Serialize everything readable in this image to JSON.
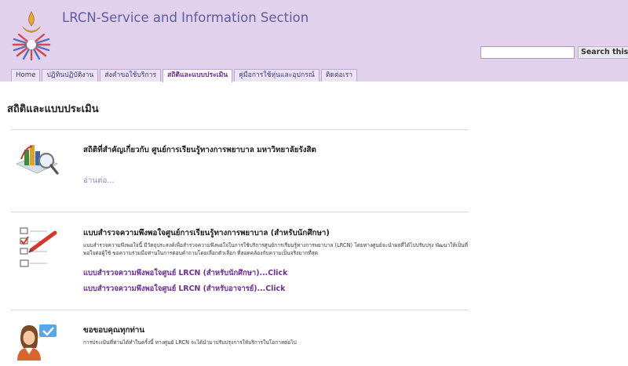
{
  "site": {
    "title": "LRCN-Service and Information Section"
  },
  "search": {
    "placeholder": "",
    "button_label": "Search this site"
  },
  "nav": {
    "tabs": [
      {
        "label": "Home"
      },
      {
        "label": "ปฏิทินปฏิบัติงาน"
      },
      {
        "label": "ส่งคำขอใช้บริการ"
      },
      {
        "label": "สถิติและแบบประเมิน"
      },
      {
        "label": "คู่มือการใช้หุ่นและอุปกรณ์"
      },
      {
        "label": "ติดต่อเรา"
      }
    ],
    "active_index": 3
  },
  "page": {
    "title": "สถิติและแบบประเมิน"
  },
  "sections": {
    "stats": {
      "heading": "สถิติที่สำคัญเกี่ยวกับ ศูนย์การเรียนรู้ทางการพยาบาล มหาวิทยาลัยรังสิต",
      "read_more": "อ่านต่อ...",
      "icon": "chart-magnifier-icon"
    },
    "survey": {
      "heading": "แบบสำรวจความพึงพอใจศูนย์การเรียนรู้ทางการพยาบาล (สำหรับนักศึกษา)",
      "description": "แบบสำรวจความพึงพอใจนี้ มีวัตถุประสงค์เพื่อสำรวจความพึงพอใจในการใช้บริการศูนย์การเรียนรู้ทางการพยาบาล (LRCN) โดยทางศูนย์จะนำผลที่ได้ไปปรับปรุง พัฒนาให้เป็นที่พอใจต่อผู้ใช้ ขอความร่วมมือท่านในการตอบคำถามโดยเลือกตัวเลือก ที่สอดคล้องกับความเป็นจริงมากที่สุด",
      "links": [
        {
          "label": "แบบสำรวจความพึงพอใจศูนย์ LRCN (สำหรับนักศึกษา)...Click"
        },
        {
          "label": "แบบสำรวจความพึงพอใจศูนย์ LRCN (สำหรับอาจารย์)...Click"
        }
      ],
      "icon": "checklist-icon"
    },
    "thanks": {
      "heading": "ขอขอบคุณทุกท่าน",
      "description": "การประเมินที่ท่านได้ทำในครั้งนี้ ทางศูนย์ LRCN จะได้นำมาปรับปรุงการให้บริการในโอกาสต่อไป",
      "icon": "person-check-icon"
    }
  },
  "colors": {
    "header_bg": "#e1d1ec",
    "title": "#5e5d9e",
    "tab_bg": "#ece4f3",
    "link": "#6e2f94",
    "read_more": "#9b87bb"
  }
}
